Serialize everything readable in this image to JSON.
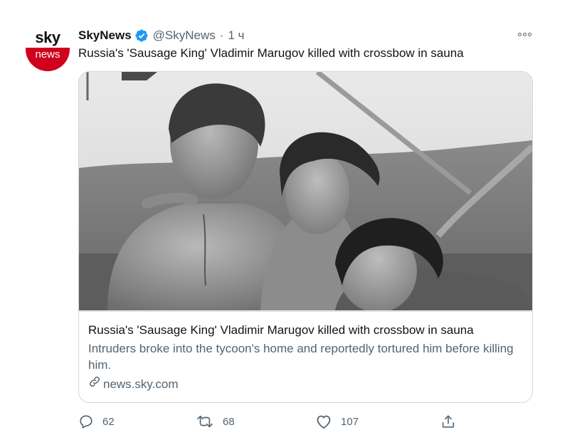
{
  "author": {
    "name": "SkyNews",
    "handle": "@SkyNews",
    "separator": "·",
    "time": "1 ч",
    "avatar_top_text": "sky",
    "avatar_bottom_text": "news",
    "avatar_color": "#d0021b",
    "verified_color": "#1d9bf0"
  },
  "tweet": {
    "text": "Russia's 'Sausage King' Vladimir Marugov killed with crossbow in sauna"
  },
  "card": {
    "title": "Russia's 'Sausage King' Vladimir Marugov killed with crossbow in sauna",
    "description": "Intruders broke into the tycoon's home and reportedly tortured him before killing him.",
    "domain": "news.sky.com",
    "image": "black-and-white photo of three people on a boat"
  },
  "actions": {
    "reply_count": "62",
    "retweet_count": "68",
    "like_count": "107",
    "icons": [
      "reply-icon",
      "retweet-icon",
      "like-icon",
      "share-icon"
    ]
  },
  "colors": {
    "text": "#0f1419",
    "secondary": "#536471",
    "border": "#cfd9de"
  }
}
